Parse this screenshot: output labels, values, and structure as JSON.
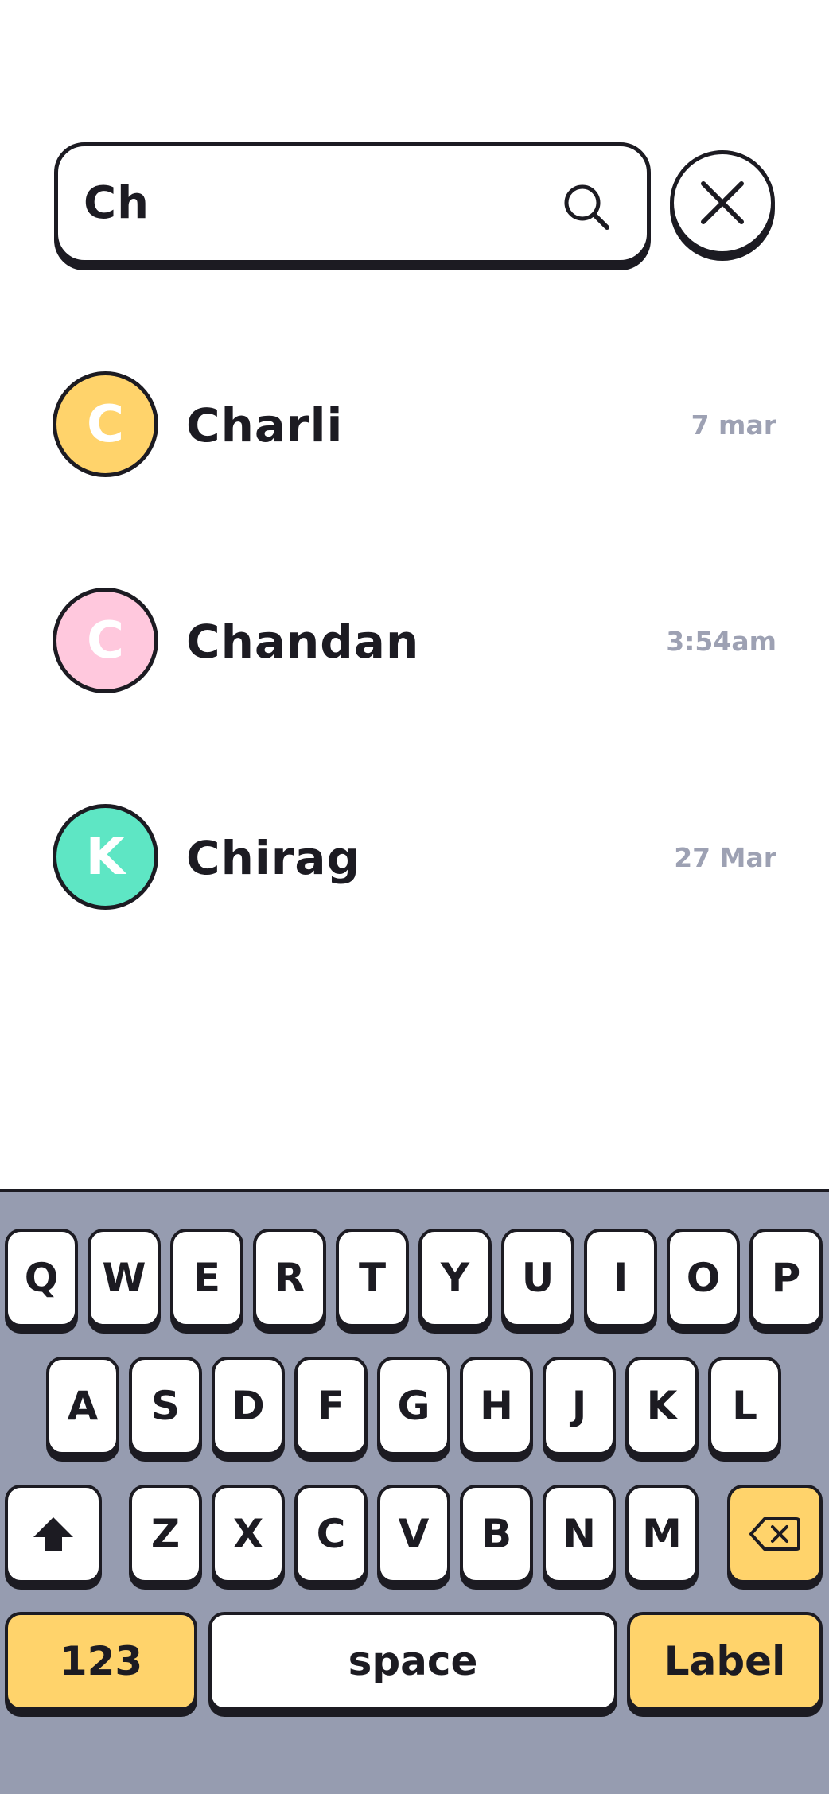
{
  "search": {
    "value": "Ch"
  },
  "contacts": [
    {
      "initial": "C",
      "name": "Charli",
      "time": "7 mar",
      "color": "#ffd36b"
    },
    {
      "initial": "C",
      "name": "Chandan",
      "time": "3:54am",
      "color": "#ffc8dd"
    },
    {
      "initial": "K",
      "name": "Chirag",
      "time": "27 Mar",
      "color": "#5ee6c4"
    }
  ],
  "keyboard": {
    "row1": [
      "Q",
      "W",
      "E",
      "R",
      "T",
      "Y",
      "U",
      "I",
      "O",
      "P"
    ],
    "row2": [
      "A",
      "S",
      "D",
      "F",
      "G",
      "H",
      "J",
      "K",
      "L"
    ],
    "row3": [
      "Z",
      "X",
      "C",
      "V",
      "B",
      "N",
      "M"
    ],
    "numbers_label": "123",
    "space_label": "space",
    "action_label": "Label",
    "shift_icon": "shift-arrow-icon",
    "delete_icon": "backspace-icon"
  },
  "colors": {
    "ink": "#1c1b22",
    "accent": "#ffd36b",
    "keyboard_bg": "#969cb0",
    "muted_text": "#9da1b3"
  }
}
